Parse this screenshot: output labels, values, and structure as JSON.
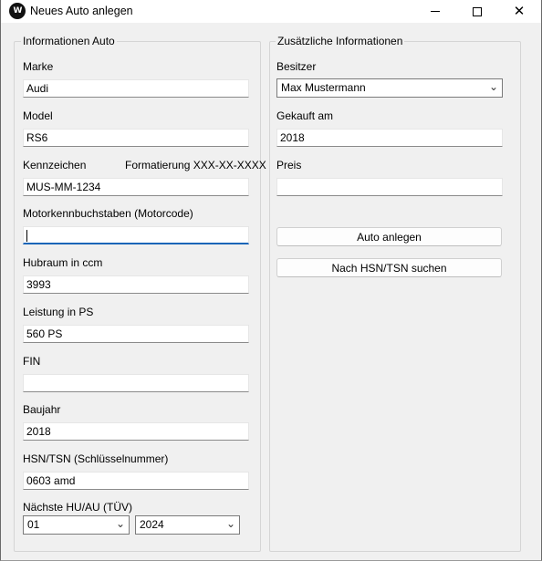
{
  "window": {
    "title": "Neues Auto anlegen",
    "icon_name": "app-logo-icon"
  },
  "left_group": {
    "legend": "Informationen Auto",
    "marke": {
      "label": "Marke",
      "value": "Audi"
    },
    "model": {
      "label": "Model",
      "value": "RS6"
    },
    "kennzeichen": {
      "label": "Kennzeichen",
      "hint": "Formatierung XXX-XX-XXXX",
      "value": "MUS-MM-1234"
    },
    "motorcode": {
      "label": "Motorkennbuchstaben  (Motorcode)",
      "value": ""
    },
    "hubraum": {
      "label": "Hubraum in ccm",
      "value": "3993"
    },
    "leistung": {
      "label": "Leistung in PS",
      "value": "560 PS"
    },
    "fin": {
      "label": "FIN",
      "value": ""
    },
    "baujahr": {
      "label": "Baujahr",
      "value": "2018"
    },
    "hsn_tsn": {
      "label": "HSN/TSN (Schlüsselnummer)",
      "value": "0603 amd"
    },
    "tuev": {
      "label": "Nächste HU/AU (TÜV)",
      "month": "01",
      "year": "2024"
    }
  },
  "right_group": {
    "legend": "Zusätzliche Informationen",
    "besitzer": {
      "label": "Besitzer",
      "value": "Max Mustermann"
    },
    "gekauft": {
      "label": "Gekauft am",
      "value": "2018"
    },
    "preis": {
      "label": "Preis",
      "value": ""
    },
    "btn_create": "Auto anlegen",
    "btn_search": "Nach HSN/TSN suchen"
  }
}
